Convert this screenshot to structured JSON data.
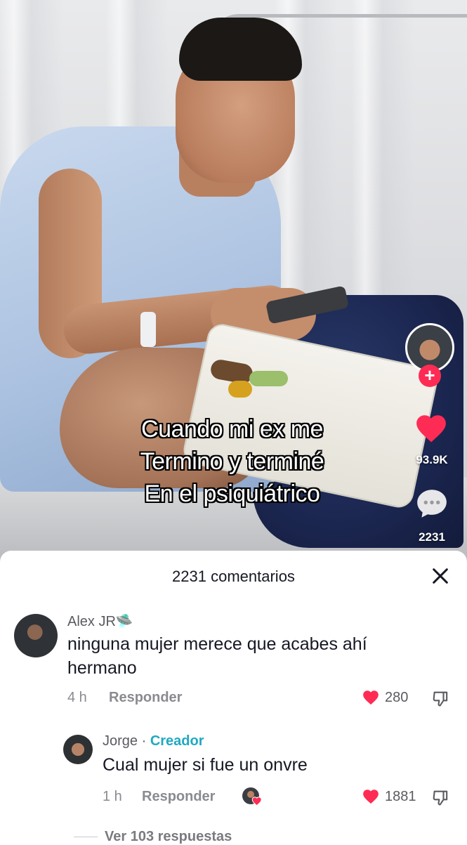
{
  "video": {
    "caption_lines": [
      "Cuando mi ex me",
      "Termino y terminé",
      "En el psiquiátrico"
    ],
    "like_count": "93.9K",
    "comment_count": "2231"
  },
  "comments_panel": {
    "title": "2231 comentarios",
    "comments": [
      {
        "username": "Alex JR🛸",
        "text_line1": "ninguna mujer merece que acabes ahí",
        "text_line2": "hermano",
        "time": "4 h",
        "reply_label": "Responder",
        "likes": "280"
      }
    ],
    "reply": {
      "username": "Jorge",
      "separator": "·",
      "badge": "Creador",
      "text": "Cual mujer si fue un onvre",
      "time": "1 h",
      "reply_label": "Responder",
      "likes": "1881"
    },
    "view_replies": "Ver 103 respuestas"
  },
  "colors": {
    "like_red": "#fe2c55",
    "creator_badge": "#20a9c2"
  },
  "icons": [
    "close-icon",
    "heart-icon",
    "comment-icon",
    "dislike-icon",
    "plus-icon"
  ]
}
